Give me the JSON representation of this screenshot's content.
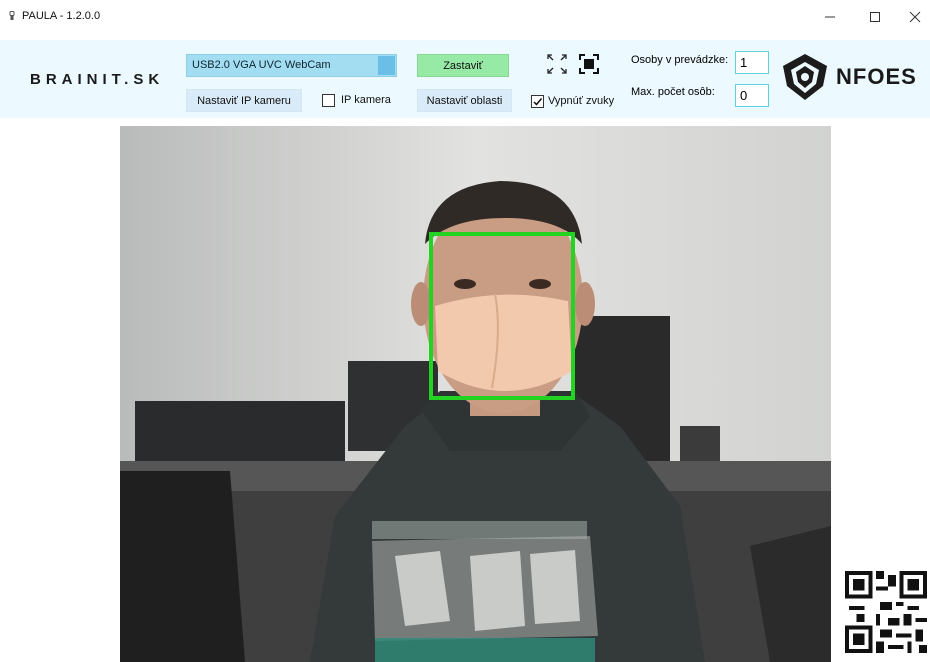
{
  "window": {
    "title": "PAULA - 1.2.0.0",
    "controls": [
      "minimize",
      "maximize",
      "close"
    ]
  },
  "toolbar": {
    "brand": "BRAINIT.SK",
    "camera_select": {
      "value": "USB2.0 VGA UVC WebCam"
    },
    "stop_button": "Zastaviť",
    "set_ip_camera_button": "Nastaviť IP kameru",
    "ip_camera_checkbox": {
      "label": "IP kamera",
      "checked": false
    },
    "set_areas_button": "Nastaviť oblasti",
    "mute_checkbox": {
      "label": "Vypnúť zvuky",
      "checked": true
    },
    "persons_inside_label": "Osoby v prevádzke:",
    "persons_inside_value": "1",
    "max_persons_label": "Max. počet osôb:",
    "max_persons_value": "0",
    "partner_logo_text": "NFOES",
    "icons": [
      "expand-icon",
      "fullscreen-icon",
      "checkmark-icon",
      "nfoes-logo-icon"
    ]
  },
  "camera_feed": {
    "detection_color": "#22d322",
    "faces_detected": 1
  },
  "colors": {
    "toolbar_bg": "#ecfaff",
    "select_bg": "#a3ddf2",
    "stop_button_bg": "#97eaa6",
    "button_bg": "#d9ebf9",
    "input_border": "#5fd0e0"
  }
}
